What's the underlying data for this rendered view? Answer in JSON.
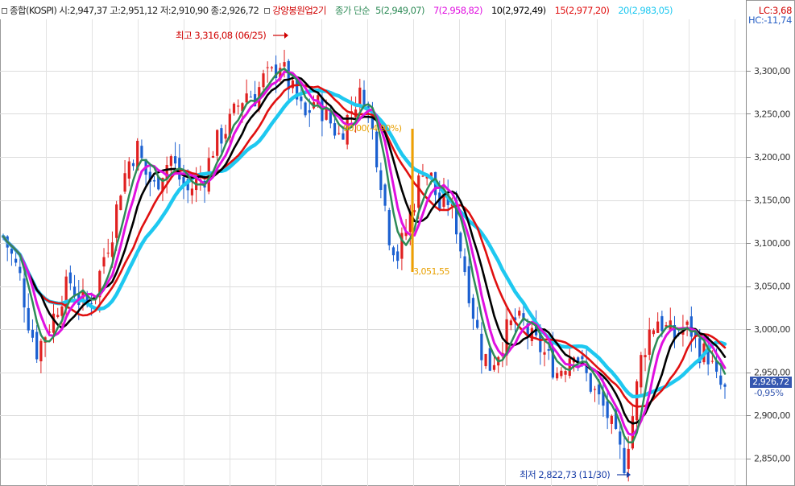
{
  "legend": {
    "index_info": "종합(KOSPI) 시:2,947,37 고:2,951,12 저:2,910,90 종:2,926,72",
    "indicator": "강양봉원업2기",
    "ma_title": "종가 단순",
    "ma_entries": [
      {
        "text": "5(2,949,07)",
        "color": "#2e8b57"
      },
      {
        "text": "7(2,958,82)",
        "color": "#e010e0"
      },
      {
        "text": "10(2,972,49)",
        "color": "#000000"
      },
      {
        "text": "15(2,977,20)",
        "color": "#e01010"
      },
      {
        "text": "20(2,983,05)",
        "color": "#1ec8f0"
      }
    ]
  },
  "lc_label": "LC:3,68",
  "hc_label": "HC:-11,74",
  "current_price_label": "2,926,72",
  "current_change_label": "-0,95%",
  "annotations": {
    "high": "최고 3,316,08 (06/25)",
    "low": "최저 2,822,73 (11/30)",
    "swing_text": "90,00(-4,90%)",
    "swing_low": "3,051,55"
  },
  "chart_data": {
    "type": "candlestick",
    "title": "종합(KOSPI)",
    "ylim": [
      2818,
      3356
    ],
    "yticks": [
      2850,
      2900,
      2950,
      3000,
      3050,
      3100,
      3150,
      3200,
      3250,
      3300
    ],
    "ytick_labels": [
      "2,850,00",
      "2,900,00",
      "2,950,00",
      "3,000,00",
      "3,050,00",
      "3,100,00",
      "3,150,00",
      "3,200,00",
      "3,250,00",
      "3,300,00"
    ],
    "grid": true,
    "up_color": "#e02020",
    "down_color": "#1a5fd0",
    "close_series": [
      3108,
      3085,
      3060,
      3010,
      2975,
      2995,
      3015,
      3040,
      3055,
      3035,
      3030,
      3045,
      3085,
      3115,
      3165,
      3195,
      3210,
      3180,
      3165,
      3185,
      3200,
      3175,
      3160,
      3170,
      3178,
      3210,
      3225,
      3240,
      3260,
      3275,
      3270,
      3290,
      3295,
      3310,
      3285,
      3265,
      3245,
      3265,
      3255,
      3240,
      3225,
      3245,
      3265,
      3275,
      3230,
      3175,
      3110,
      3085,
      3115,
      3150,
      3190,
      3175,
      3140,
      3150,
      3120,
      3070,
      3020,
      2975,
      2958,
      2975,
      2998,
      3010,
      3005,
      2988,
      2978,
      2965,
      2950,
      2962,
      2980,
      2955,
      2935,
      2918,
      2900,
      2870,
      2845,
      2900,
      2965,
      2998,
      3012,
      3000,
      2992,
      3002,
      2998,
      2975,
      2970,
      2940,
      2927
    ],
    "moving_averages": [
      {
        "period": 5,
        "color": "#2e8b57",
        "last": 2949.07
      },
      {
        "period": 7,
        "color": "#e010e0",
        "last": 2958.82
      },
      {
        "period": 10,
        "color": "#000000",
        "last": 2972.49
      },
      {
        "period": 15,
        "color": "#e01010",
        "last": 2977.2
      },
      {
        "period": 20,
        "color": "#1ec8f0",
        "last": 2983.05
      }
    ],
    "high": 3316.08,
    "low": 2822.73,
    "last_close": 2926.72,
    "change_pct": -0.95
  }
}
